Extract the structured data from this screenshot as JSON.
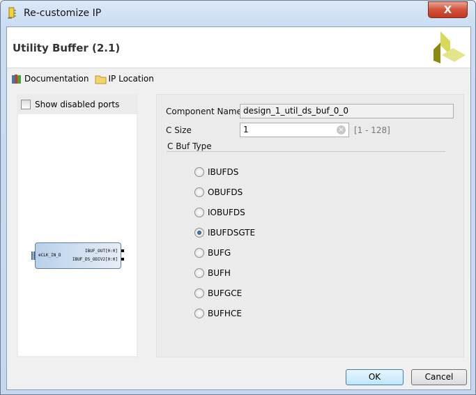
{
  "window": {
    "title": "Re-customize IP",
    "close_label": "X"
  },
  "header": {
    "title": "Utility Buffer (2.1)"
  },
  "links": [
    {
      "label": "Documentation",
      "icon": "books-icon"
    },
    {
      "label": "IP Location",
      "icon": "folder-icon"
    }
  ],
  "left": {
    "show_disabled_ports": "Show disabled ports",
    "block": {
      "input": "CLK_IN_D",
      "outputs": [
        "IBUF_OUT[0:0]",
        "IBUF_DS_ODIV2[0:0]"
      ]
    }
  },
  "form": {
    "component_name_label": "Component Name",
    "component_name": "design_1_util_ds_buf_0_0",
    "c_size_label": "C Size",
    "c_size": "1",
    "c_size_range": "[1 - 128]",
    "c_buf_type_label": "C Buf Type",
    "options": [
      "IBUFDS",
      "OBUFDS",
      "IOBUFDS",
      "IBUFDSGTE",
      "BUFG",
      "BUFH",
      "BUFGCE",
      "BUFHCE"
    ],
    "selected": "IBUFDSGTE"
  },
  "buttons": {
    "ok": "OK",
    "cancel": "Cancel"
  }
}
